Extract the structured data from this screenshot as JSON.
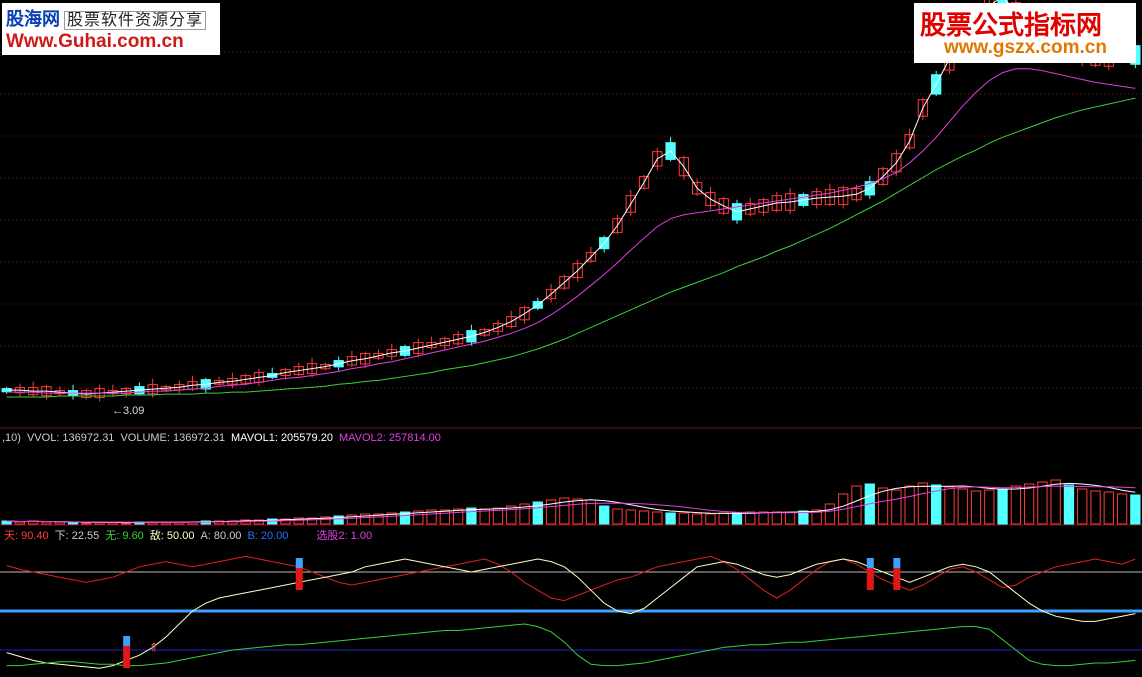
{
  "watermarks": {
    "left_brand": "股海网",
    "left_slogan": "股票软件资源分享",
    "left_url": "Www.Guhai.com.cn",
    "right_title": "股票公式指标网",
    "right_url": "www.gszx.com.cn"
  },
  "colors": {
    "background": "#000000",
    "candle_up": "#ff3b3b",
    "candle_down": "#54ffff",
    "ma_fast": "#ffffff",
    "ma_mid": "#ffffff",
    "ma_slow": "#e040e0",
    "ma_long": "#3ad13a",
    "grid": "#8a1010",
    "vol_ma1": "#ffffff",
    "vol_ma2": "#e040e0",
    "line_tian": "#e02020",
    "line_di": "#ffffc8",
    "line_wu": "#3ad13a",
    "ref_blue": "#3ea0ff",
    "ref_navy": "#2020c8"
  },
  "price_panel": {
    "low_marker": "←3.09"
  },
  "volume_panel": {
    "prefix": ",10)",
    "vvol_label": "VVOL: 136972.31",
    "volume_label": "VOLUME: 136972.31",
    "mavol1_label": "MAVOL1: 205579.20",
    "mavol2_label": "MAVOL2: 257814.00"
  },
  "indicator_panel": {
    "tian": "天: 90.40",
    "xia": "下: 22.55",
    "wu": "无: 9.60",
    "di": "敌: 50.00",
    "a": "A: 80.00",
    "b": "B: 20.00",
    "xuangu": "选股2: 1.00"
  },
  "chart_data": [
    {
      "type": "candlestick",
      "panel": "price",
      "low_label": 3.09,
      "series": [
        {
          "name": "MA_fast",
          "values": [
            8,
            8,
            7,
            7,
            6,
            5,
            4,
            5,
            6,
            7,
            8,
            9,
            10,
            11,
            13,
            14,
            16,
            17,
            19,
            21,
            23,
            26,
            28,
            30,
            32,
            35,
            38,
            40,
            43,
            46,
            48,
            51,
            54,
            57,
            60,
            63,
            67,
            72,
            78,
            86,
            95,
            106,
            118,
            130,
            144,
            158,
            176,
            198,
            220,
            244,
            252,
            236,
            214,
            203,
            196,
            190,
            193,
            196,
            199,
            200,
            202,
            204,
            205,
            206,
            208,
            214,
            226,
            240,
            262,
            296,
            320,
            346,
            366,
            384,
            400,
            410,
            394,
            380,
            370,
            362,
            356,
            352,
            350,
            350,
            354,
            350
          ]
        },
        {
          "name": "MA_slow",
          "values": [
            6,
            6,
            6,
            5,
            5,
            5,
            5,
            5,
            5,
            5,
            6,
            7,
            7,
            8,
            9,
            10,
            12,
            13,
            14,
            16,
            18,
            20,
            21,
            23,
            25,
            27,
            30,
            32,
            35,
            37,
            40,
            43,
            46,
            49,
            52,
            55,
            58,
            62,
            66,
            71,
            77,
            85,
            94,
            104,
            115,
            126,
            138,
            151,
            163,
            175,
            183,
            187,
            189,
            191,
            193,
            195,
            197,
            199,
            201,
            203,
            205,
            207,
            209,
            212,
            215,
            219,
            224,
            230,
            240,
            252,
            266,
            282,
            298,
            312,
            324,
            332,
            336,
            336,
            334,
            331,
            328,
            325,
            322,
            320,
            318,
            316
          ]
        },
        {
          "name": "MA_long",
          "values": [
            1,
            1,
            1,
            1,
            2,
            2,
            2,
            2,
            2,
            3,
            3,
            3,
            4,
            4,
            4,
            5,
            5,
            6,
            6,
            7,
            8,
            9,
            10,
            11,
            12,
            14,
            15,
            17,
            18,
            20,
            22,
            24,
            26,
            29,
            31,
            33,
            36,
            39,
            42,
            46,
            50,
            55,
            60,
            66,
            72,
            78,
            84,
            90,
            96,
            102,
            108,
            113,
            118,
            123,
            128,
            134,
            139,
            144,
            150,
            155,
            161,
            167,
            173,
            180,
            187,
            194,
            201,
            209,
            217,
            225,
            233,
            240,
            247,
            253,
            260,
            266,
            271,
            276,
            281,
            286,
            290,
            294,
            297,
            300,
            303,
            306
          ]
        }
      ]
    },
    {
      "type": "bar",
      "panel": "volume",
      "series": [
        {
          "name": "VOLUME",
          "values": [
            3,
            2,
            3,
            2,
            2,
            1,
            1,
            2,
            2,
            1,
            2,
            2,
            2,
            2,
            2,
            3,
            3,
            3,
            4,
            4,
            5,
            5,
            6,
            6,
            7,
            8,
            9,
            10,
            10,
            11,
            12,
            13,
            14,
            14,
            15,
            16,
            15,
            16,
            18,
            20,
            22,
            24,
            26,
            25,
            24,
            18,
            15,
            14,
            13,
            12,
            11,
            11,
            10,
            10,
            11,
            11,
            12,
            12,
            12,
            12,
            13,
            14,
            20,
            30,
            38,
            40,
            36,
            34,
            38,
            41,
            39,
            37,
            35,
            33,
            34,
            35,
            38,
            40,
            42,
            44,
            39,
            35,
            33,
            32,
            30,
            29
          ]
        }
      ]
    },
    {
      "type": "line",
      "panel": "indicator",
      "reference_lines": [
        80,
        50,
        20
      ],
      "series": [
        {
          "name": "天",
          "values": [
            85,
            82,
            80,
            78,
            76,
            74,
            72,
            74,
            76,
            80,
            84,
            86,
            88,
            86,
            84,
            86,
            88,
            90,
            92,
            90,
            88,
            86,
            84,
            80,
            76,
            72,
            70,
            72,
            74,
            76,
            78,
            80,
            82,
            84,
            86,
            88,
            90,
            86,
            80,
            72,
            66,
            60,
            58,
            62,
            66,
            70,
            74,
            76,
            80,
            84,
            86,
            88,
            90,
            92,
            88,
            82,
            74,
            66,
            60,
            66,
            74,
            82,
            88,
            90,
            86,
            80,
            74,
            70,
            66,
            70,
            76,
            82,
            84,
            80,
            74,
            68,
            70,
            76,
            80,
            84,
            86,
            88,
            90,
            88,
            86,
            90
          ]
        },
        {
          "name": "地",
          "values": [
            18,
            15,
            12,
            10,
            9,
            8,
            7,
            6,
            8,
            12,
            16,
            22,
            30,
            40,
            50,
            56,
            60,
            62,
            64,
            66,
            68,
            70,
            72,
            74,
            76,
            78,
            80,
            84,
            86,
            88,
            90,
            88,
            86,
            84,
            82,
            80,
            82,
            84,
            86,
            88,
            90,
            88,
            84,
            76,
            66,
            56,
            50,
            48,
            52,
            60,
            68,
            76,
            84,
            86,
            88,
            86,
            82,
            78,
            76,
            78,
            82,
            86,
            88,
            90,
            88,
            84,
            80,
            76,
            72,
            76,
            80,
            84,
            86,
            84,
            80,
            72,
            64,
            56,
            50,
            46,
            44,
            42,
            42,
            44,
            46,
            48
          ]
        },
        {
          "name": "无",
          "values": [
            8,
            8,
            9,
            10,
            11,
            11,
            10,
            9,
            9,
            8,
            8,
            9,
            10,
            12,
            14,
            16,
            18,
            20,
            21,
            22,
            23,
            24,
            24,
            25,
            26,
            27,
            28,
            29,
            30,
            31,
            32,
            33,
            34,
            35,
            35,
            36,
            37,
            38,
            39,
            40,
            38,
            34,
            26,
            16,
            9,
            8,
            8,
            9,
            10,
            12,
            14,
            16,
            18,
            20,
            22,
            23,
            24,
            24,
            25,
            26,
            26,
            27,
            28,
            29,
            30,
            31,
            32,
            33,
            34,
            35,
            36,
            37,
            38,
            38,
            36,
            28,
            20,
            12,
            9,
            8,
            8,
            9,
            10,
            10,
            11,
            12
          ]
        }
      ]
    }
  ]
}
